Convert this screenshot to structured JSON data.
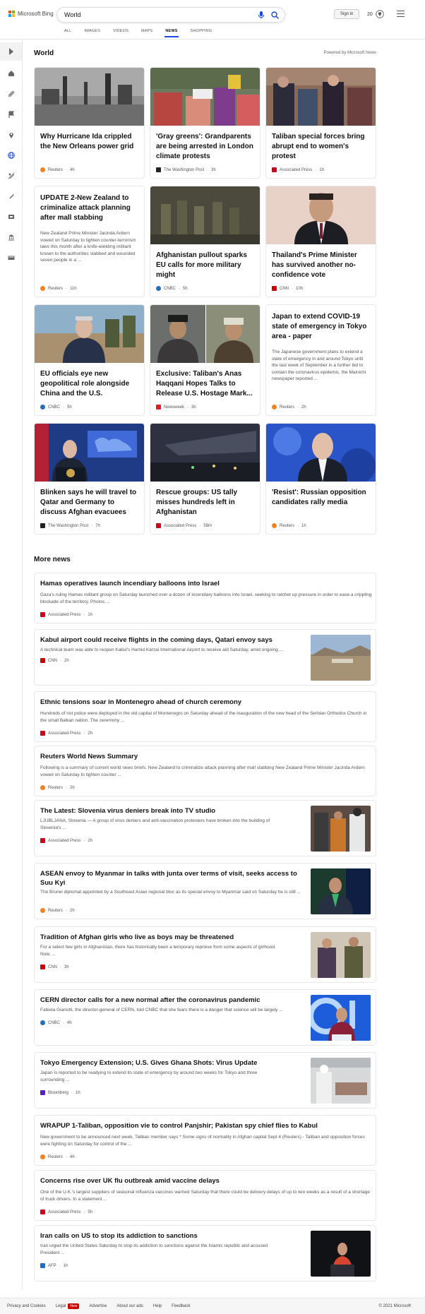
{
  "brand": {
    "name": "Microsoft Bing",
    "logo_colors": [
      "#f25022",
      "#7fba00",
      "#00a4ef",
      "#ffb900"
    ]
  },
  "search": {
    "value": "World"
  },
  "header": {
    "signin_label": "Sign in",
    "rewards_count": "20"
  },
  "tabs": [
    {
      "label": "ALL"
    },
    {
      "label": "IMAGES"
    },
    {
      "label": "VIDEOS"
    },
    {
      "label": "MAPS"
    },
    {
      "label": "NEWS",
      "active": true
    },
    {
      "label": "SHOPPING"
    }
  ],
  "rail_icons": [
    "expand-icon",
    "home-icon",
    "filter-icon",
    "flag-icon",
    "location-icon",
    "globe-icon",
    "science-icon",
    "rocket-icon",
    "entertainment-icon",
    "politics-icon",
    "money-icon"
  ],
  "section": {
    "title": "World",
    "powered_by": "Powered by Microsoft News"
  },
  "cards": [
    {
      "title": "Why Hurricane Ida crippled the New Orleans power grid",
      "source": "Reuters",
      "time": "4h"
    },
    {
      "title": "'Gray greens': Grandparents are being arrested in London climate protests",
      "source": "The Washington Post",
      "time": "3h"
    },
    {
      "title": "Taliban special forces bring abrupt end to women's protest",
      "source": "Associated Press",
      "time": "1h"
    },
    {
      "title": "UPDATE 2-New Zealand to criminalize attack planning after mall stabbing",
      "snippet": "New Zealand Prime Minister Jacinda Ardern vowed on Saturday to tighten counter-terrorism laws this month after a knife-wielding militant known to the authorities stabbed and wounded seven people in a ...",
      "source": "Reuters",
      "time": "11h"
    },
    {
      "title": "Afghanistan pullout sparks EU calls for more military might",
      "source": "CNBC",
      "time": "5h"
    },
    {
      "title": "Thailand's Prime Minister has survived another no-confidence vote",
      "source": "CNN",
      "time": "10h"
    },
    {
      "title": "EU officials eye new geopolitical role alongside China and the U.S.",
      "source": "CNBC",
      "time": "5h"
    },
    {
      "title": "Exclusive: Taliban's Anas Haqqani Hopes Talks to Release U.S. Hostage Mark...",
      "source": "Newsweek",
      "time": "3h"
    },
    {
      "title": "Japan to extend COVID-19 state of emergency in Tokyo area - paper",
      "snippet": "The Japanese government plans to extend a state of emergency in and around Tokyo until the last week of September in a further bid to contain the coronavirus epidemic, the Mainichi newspaper reported ...",
      "source": "Reuters",
      "time": "2h"
    },
    {
      "title": "Blinken says he will travel to Qatar and Germany to discuss Afghan evacuees",
      "source": "The Washington Post",
      "time": "7h"
    },
    {
      "title": "Rescue groups: US tally misses hundreds left in Afghanistan",
      "source": "Associated Press",
      "time": "58m"
    },
    {
      "title": "'Resist': Russian opposition candidates rally media",
      "source": "Reuters",
      "time": "1h"
    }
  ],
  "more_news": {
    "title": "More news",
    "items": [
      {
        "title": "Hamas operatives launch incendiary balloons into Israel",
        "snippet": "Gaza's ruling Hamas militant group on Saturday launched over a dozen of incendiary balloons into Israel, seeking to ratchet up pressure in order to ease a crippling blockade of the territory. Photos ...",
        "source": "Associated Press",
        "time": "1h"
      },
      {
        "title": "Kabul airport could receive flights in the coming days, Qatari envoy says",
        "snippet": "A technical team was able to reopen Kabul's Hamid Karzai International Airport to receive aid Saturday, amid ongoing ...",
        "source": "CNN",
        "time": "2h"
      },
      {
        "title": "Ethnic tensions soar in Montenegro ahead of church ceremony",
        "snippet": "Hundreds of riot police were deployed in the old capital of Montenegro on Saturday ahead of the inauguration of the new head of the Serbian Orthodox Church in the small Balkan nation. The ceremony ...",
        "source": "Associated Press",
        "time": "2h"
      },
      {
        "title": "Reuters World News Summary",
        "snippet": "Following is a summary of current world news briefs. New Zealand to criminalize attack planning after mall stabbing New Zealand Prime Minister Jacinda Ardern vowed on Saturday to tighten counter ...",
        "source": "Reuters",
        "time": "2h"
      },
      {
        "title": "The Latest: Slovenia virus deniers break into TV studio",
        "snippet": "LJUBLJANA, Slovenia — A group of virus deniers and anti-vaccination protesters have broken into the building of Slovenia's ...",
        "source": "Associated Press",
        "time": "2h"
      },
      {
        "title": "ASEAN envoy to Myanmar in talks with junta over terms of visit, seeks access to Suu Kyi",
        "snippet": "The Brunei diplomat appointed by a Southeast Asian regional bloc as its special envoy to Myanmar said on Saturday he is still ...",
        "source": "Reuters",
        "time": "2h"
      },
      {
        "title": "Tradition of Afghan girls who live as boys may be threatened",
        "snippet": "For a select few girls in Afghanistan, there has historically been a temporary reprieve from some aspects of girlhood. Now, ...",
        "source": "CNN",
        "time": "3h"
      },
      {
        "title": "CERN director calls for a new normal after the coronavirus pandemic",
        "snippet": "Fabiola Gianotti, the director-general of CERN, told CNBC that she fears there is a danger that science will be largely ...",
        "source": "CNBC",
        "time": "4h"
      },
      {
        "title": "Tokyo Emergency Extension; U.S. Gives Ghana Shots: Virus Update",
        "snippet": "Japan is reported to be readying to extend its state of emergency by around two weeks for Tokyo and three surrounding ...",
        "source": "Bloomberg",
        "time": "1h"
      },
      {
        "title": "WRAPUP 1-Taliban, opposition vie to control Panjshir; Pakistan spy chief flies to Kabul",
        "snippet": "New government to be announced next week, Taliban member says * Some signs of normality in Afghan capital Sept 4 (Reuters) - Taliban and opposition forces were fighting on Saturday for control of the ...",
        "source": "Reuters",
        "time": "4h"
      },
      {
        "title": "Concerns rise over UK flu outbreak amid vaccine delays",
        "snippet": "One of the U.K.'s largest suppliers of seasonal influenza vaccines warned Saturday that there could be delivery delays of up to two weeks as a result of a shortage of truck drivers. In a statement ...",
        "source": "Associated Press",
        "time": "5h"
      },
      {
        "title": "Iran calls on US to stop its addiction to sanctions",
        "snippet": "Iran urged the United States Saturday to stop its addiction to sanctions against the Islamic republic and accused President ...",
        "source": "AFP",
        "time": "1h"
      }
    ]
  },
  "footer": {
    "links": [
      "Privacy and Cookies",
      "Legal",
      "Advertise",
      "About our ads",
      "Help",
      "Feedback"
    ],
    "new_badge": "New",
    "copyright": "© 2021 Microsoft"
  },
  "source_colors": {
    "Reuters": "#f58220",
    "The Washington Post": "#222222",
    "Associated Press": "#d0021b",
    "CNBC": "#2a6ebb",
    "CNN": "#cc0000",
    "Newsweek": "#e31b23",
    "Bloomberg": "#5a1ec8",
    "AFP": "#1a6fc9"
  }
}
